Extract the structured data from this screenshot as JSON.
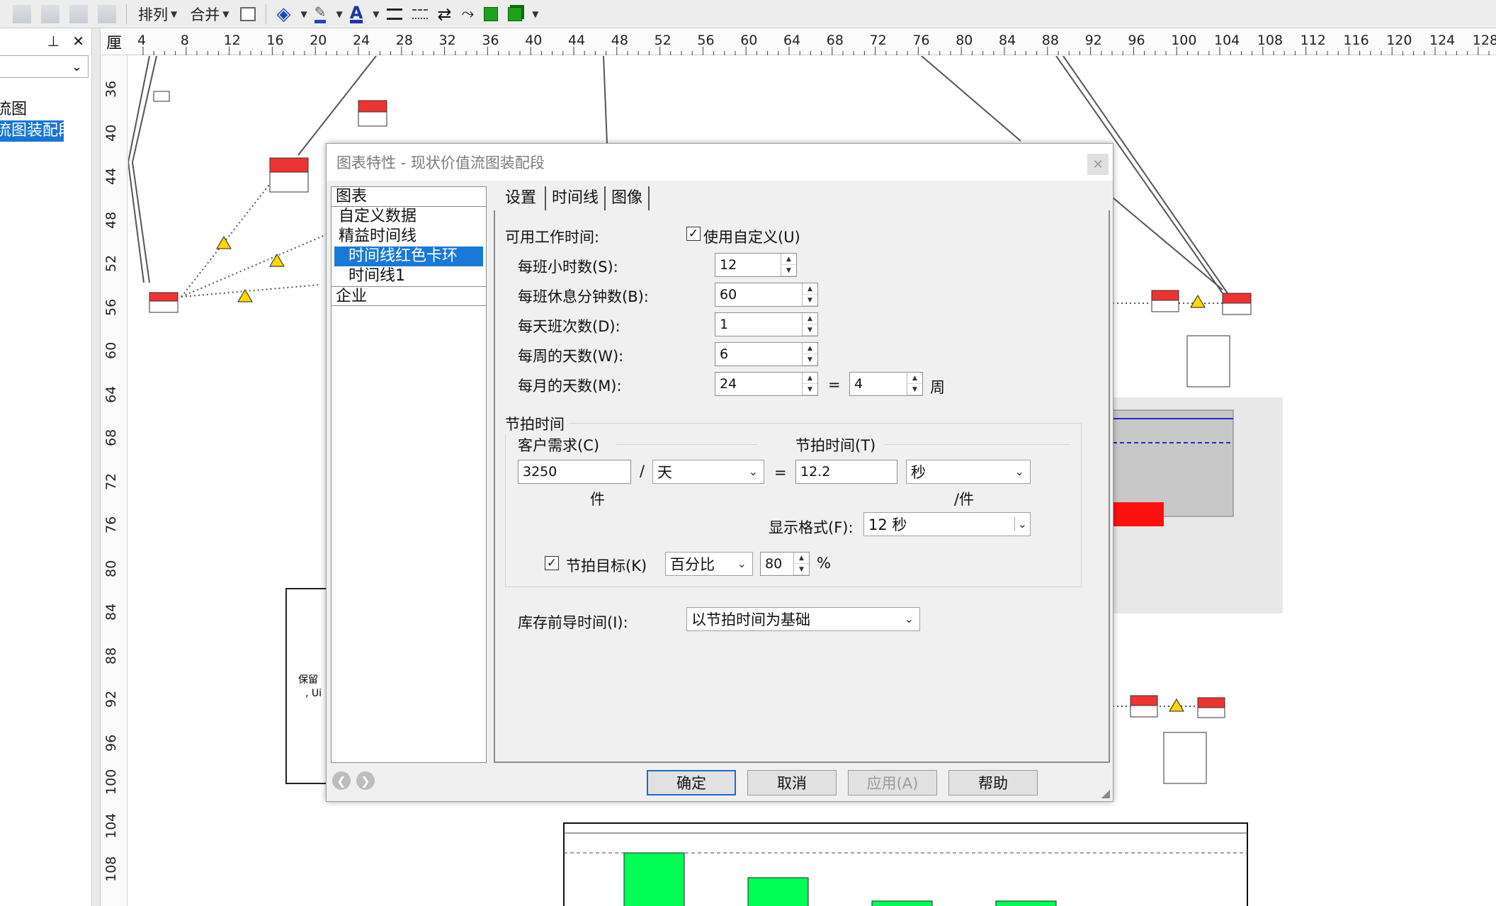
{
  "toolbar": {
    "arrange_label": "排列",
    "merge_label": "合并"
  },
  "left_panel": {
    "pin_icon": "pin-icon",
    "close_icon": "close-icon",
    "tree_items": [
      "流图",
      "流图装配段"
    ]
  },
  "ruler": {
    "corner": "厘",
    "h_ticks": [
      "4",
      "8",
      "12",
      "16",
      "20",
      "24",
      "28",
      "32",
      "36",
      "40",
      "44",
      "48",
      "52",
      "56",
      "60",
      "64",
      "68",
      "72",
      "76",
      "80",
      "84",
      "88",
      "92",
      "96",
      "100",
      "104",
      "108",
      "112",
      "116",
      "120",
      "124",
      "128"
    ],
    "v_ticks": [
      "36",
      "40",
      "44",
      "48",
      "52",
      "56",
      "60",
      "64",
      "68",
      "72",
      "76",
      "80",
      "84",
      "88",
      "92",
      "96",
      "100",
      "104",
      "108"
    ]
  },
  "dialog": {
    "title": "图表特性 - 现状价值流图装配段",
    "tree": {
      "category_chart": "图表",
      "item_custom_data": "自定义数据",
      "item_lean_timeline": "精益时间线",
      "item_timeline_red": "时间线红色卡环",
      "item_timeline1": "时间线1",
      "category_enterprise": "企业"
    },
    "tabs": [
      "设置",
      "时间线",
      "图像"
    ],
    "available_time_label": "可用工作时间:",
    "use_custom_label": "使用自定义(U)",
    "use_custom_checked": true,
    "hours_per_shift_label": "每班小时数(S):",
    "hours_per_shift": "12",
    "break_minutes_label": "每班休息分钟数(B):",
    "break_minutes": "60",
    "shifts_per_day_label": "每天班次数(D):",
    "shifts_per_day": "1",
    "days_per_week_label": "每周的天数(W):",
    "days_per_week": "6",
    "days_per_month_label": "每月的天数(M):",
    "days_per_month": "24",
    "equals": "=",
    "weeks_value": "4",
    "weeks_unit": "周",
    "takt_group_label": "节拍时间",
    "customer_demand_label": "客户需求(C)",
    "customer_demand": "3250",
    "slash": "/",
    "demand_unit": "天",
    "demand_unit_caption": "件",
    "takt_time_label": "节拍时间(T)",
    "takt_time": "12.2",
    "takt_unit": "秒",
    "takt_unit_caption": "/件",
    "display_format_label": "显示格式(F):",
    "display_format": "12 秒",
    "takt_target_label": "节拍目标(K)",
    "takt_target_checked": true,
    "takt_target_type": "百分比",
    "takt_target_value": "80",
    "percent": "%",
    "inventory_lead_label": "库存前导时间(I):",
    "inventory_lead": "以节拍时间为基础",
    "buttons": {
      "ok": "确定",
      "cancel": "取消",
      "apply": "应用(A)",
      "help": "帮助"
    }
  },
  "canvas": {
    "box_text_1": "保留",
    "box_text_2": ", Ui"
  }
}
